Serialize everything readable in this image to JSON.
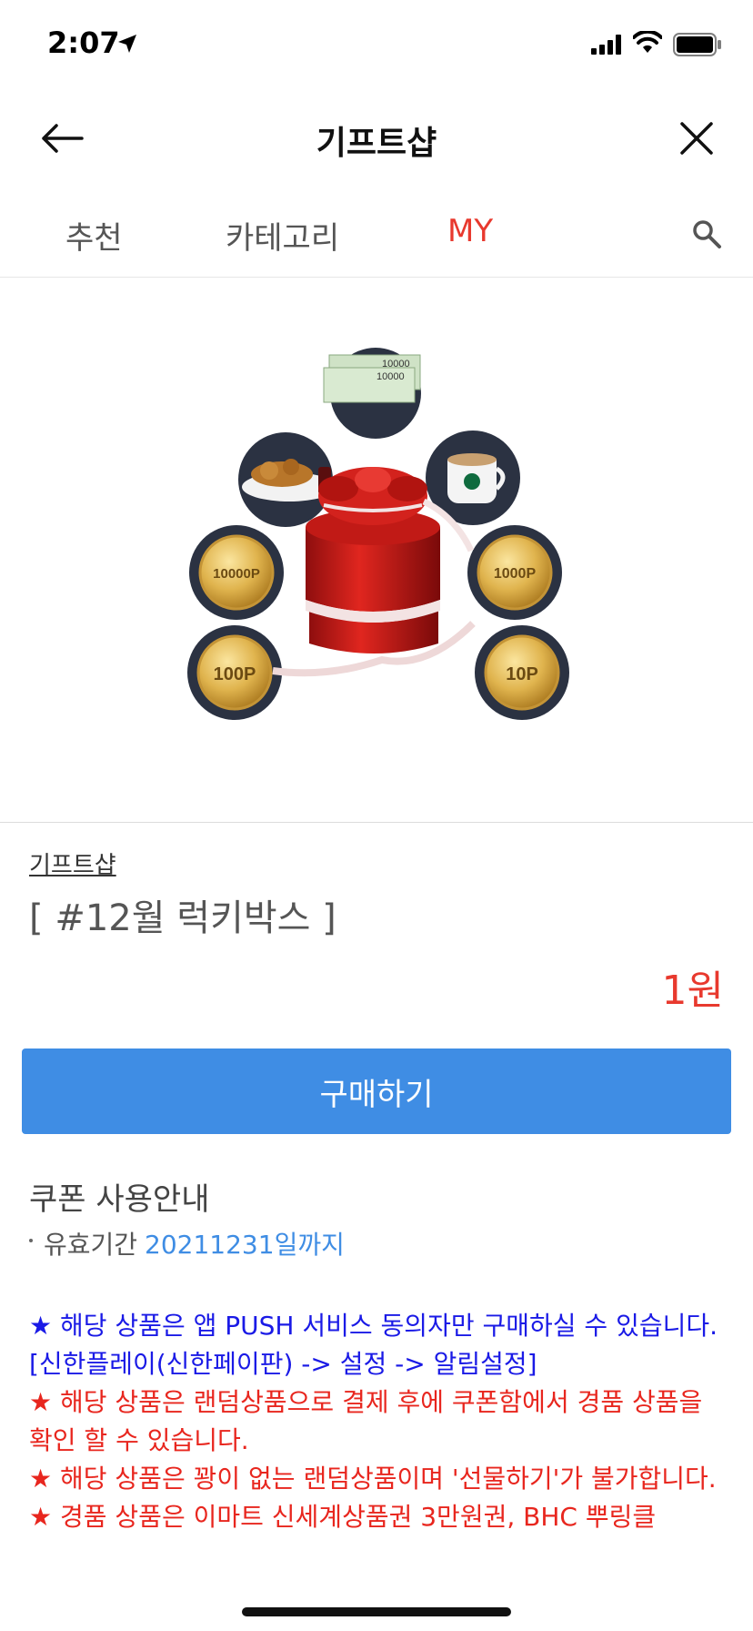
{
  "status_bar": {
    "time": "2:07"
  },
  "nav": {
    "title": "기프트샵"
  },
  "tabs": [
    {
      "label": "추천"
    },
    {
      "label": "카테고리"
    },
    {
      "label": "MY"
    }
  ],
  "hero": {
    "coins": [
      "10000P",
      "1000P",
      "100P",
      "10P"
    ],
    "voucher_text": [
      "10000",
      "10000"
    ]
  },
  "product": {
    "shop_link": "기프트샵",
    "name": "[ #12월 럭키박스 ]",
    "price": "1원"
  },
  "buy_button": {
    "label": "구매하기"
  },
  "coupon": {
    "title": "쿠폰 사용안내",
    "validity_label": "유효기간",
    "validity_value": "20211231일까지"
  },
  "notices": [
    {
      "text": "★ 해당 상품은 앱 PUSH 서비스 동의자만 구매하실 수 있습니다.",
      "color": "#1a1ae6"
    },
    {
      "text": "[신한플레이(신한페이판) -> 설정 -> 알림설정]",
      "color": "#1a1ae6"
    },
    {
      "text": "★ 해당 상품은 랜덤상품으로 결제 후에 쿠폰함에서 경품 상품을 확인 할 수 있습니다.",
      "color": "#e8261e"
    },
    {
      "text": "★ 해당 상품은 꽝이 없는 랜덤상품이며 '선물하기'가 불가합니다.",
      "color": "#e8261e"
    },
    {
      "text": "★ 경품 상품은 이마트 신세계상품권 3만원권, BHC 뿌링클",
      "color": "#e8261e"
    }
  ],
  "colors": {
    "accent_red": "#e8392e",
    "button_blue": "#3f8de4",
    "notice_blue": "#1a1ae6",
    "notice_red": "#e8261e"
  }
}
